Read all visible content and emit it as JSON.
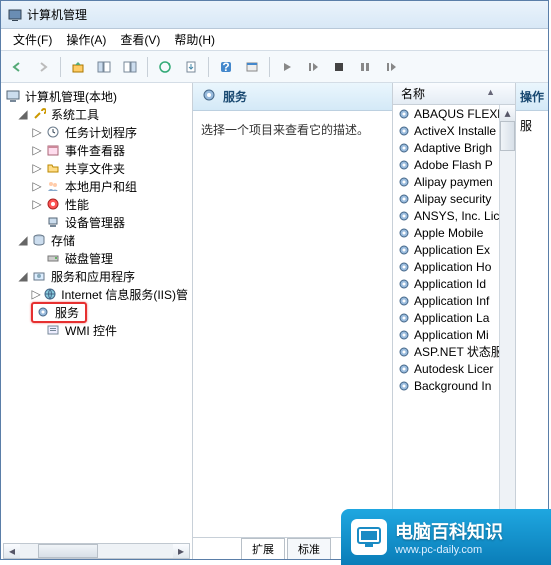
{
  "window": {
    "title": "计算机管理"
  },
  "menu": {
    "file": "文件(F)",
    "action": "操作(A)",
    "view": "查看(V)",
    "help": "帮助(H)"
  },
  "tree": {
    "root": "计算机管理(本地)",
    "system_tools": "系统工具",
    "task_scheduler": "任务计划程序",
    "event_viewer": "事件查看器",
    "shared_folders": "共享文件夹",
    "local_users": "本地用户和组",
    "performance": "性能",
    "device_manager": "设备管理器",
    "storage": "存储",
    "disk_management": "磁盘管理",
    "services_apps": "服务和应用程序",
    "iis": "Internet 信息服务(IIS)管",
    "services": "服务",
    "wmi": "WMI 控件"
  },
  "detail": {
    "header": "服务",
    "prompt": "选择一个项目来查看它的描述。"
  },
  "tabs": {
    "extended": "扩展",
    "standard": "标准"
  },
  "list": {
    "col_name": "名称",
    "items": [
      "ABAQUS FLEXl",
      "ActiveX Installe",
      "Adaptive Brigh",
      "Adobe Flash P",
      "Alipay paymen",
      "Alipay security",
      "ANSYS, Inc. Lic",
      "Apple Mobile",
      "Application Ex",
      "Application Ho",
      "Application Id",
      "Application Inf",
      "Application La",
      "Application Mi",
      "ASP.NET 状态服",
      "Autodesk Licer",
      "Background In"
    ]
  },
  "action": {
    "header": "操作",
    "item1": "服"
  },
  "watermark": {
    "cn": "电脑百科知识",
    "url": "www.pc-daily.com"
  }
}
